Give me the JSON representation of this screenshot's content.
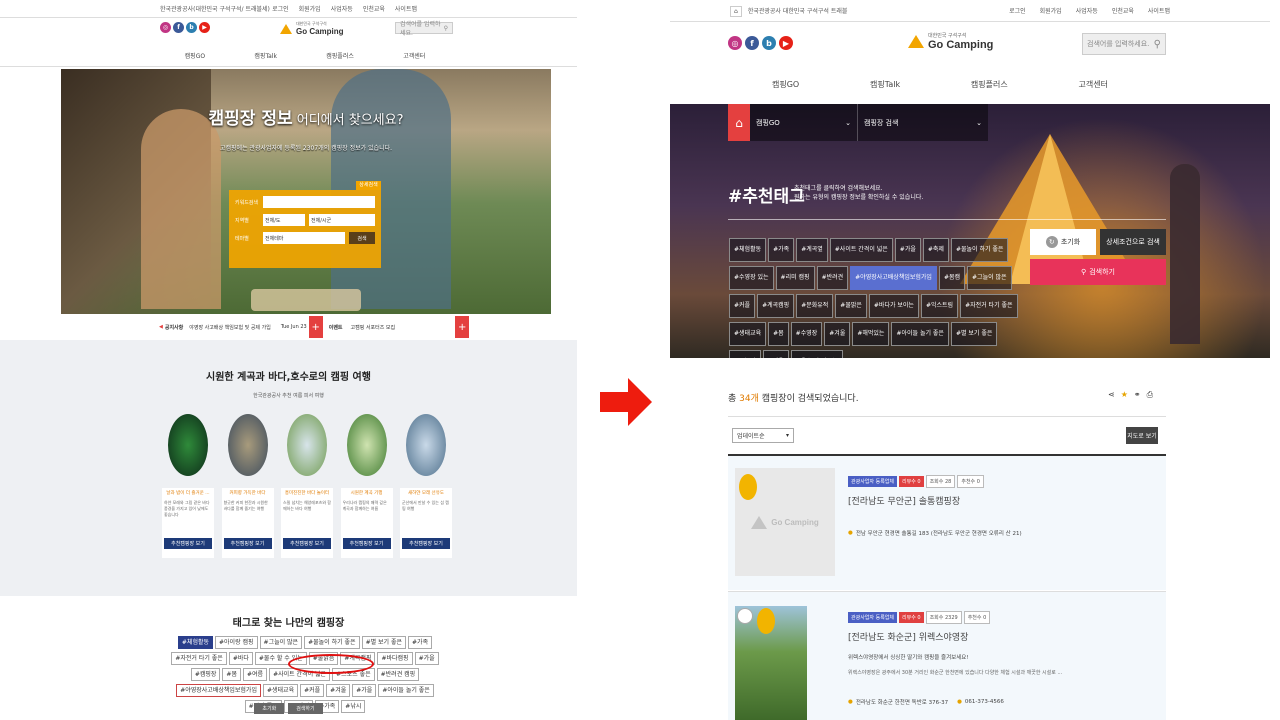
{
  "left": {
    "topbar": {
      "url": "한국관광공사(대한민국 구석구석/ 트래블세)",
      "links": [
        "로그인",
        "회원가입",
        "사업자등",
        "인천교육",
        "사이트맵"
      ]
    },
    "brand": {
      "sub": "대한민국 구석구석",
      "name": "Go Camping"
    },
    "search_placeholder": "검색어를 입력하세요.",
    "nav": [
      "캠핑GO",
      "캠핑Talk",
      "캠핑플러스",
      "고객센터"
    ],
    "hero": {
      "title_1": "캠핑장 정보",
      "title_2": " 어디에서 찾으세요?",
      "subtitle": "고캠핑에는 관광사업자에 등록된 2307개의 캠핑장 정보가 있습니다.",
      "detail_tab": "상세검색",
      "keyword_label": "키워드검색",
      "region_label": "지역별",
      "region_1": "전체/도",
      "region_2": "전체/시군",
      "theme_label": "테마별",
      "theme_value": "전체테마",
      "search_button": "검색"
    },
    "notice": {
      "label": "공지사항",
      "text": "야영장 사고배상 책임보험 및 공제 가입",
      "date": "Tue Jun 23",
      "event_label": "이벤트",
      "event_text": "고캠핑 서포터즈 모집"
    },
    "section1": {
      "title": "시원한 계곡과 바다,호수로의 캠핑 여행",
      "subtitle": "한국관광공사 추천 여름 피서 여행",
      "cards": [
        {
          "title": "날과 밤이 더 즐거운 ...",
          "desc": "하얀 모래와 그림 같은 바다풍경을 가지고 있어 낮에도 좋습니다",
          "btn": "추천캠핑장 보기"
        },
        {
          "title": "커피향 가득한 바다",
          "desc": "향긋한 커피 한잔과 시원한 바다를 함께 즐기는 여행",
          "btn": "추천캠핑장 보기"
        },
        {
          "title": "흥미진진한 바다 놀이터",
          "desc": "스릴 넘치는 해양레포츠와 함께하는 바다 여행",
          "btn": "추천캠핑장 보기"
        },
        {
          "title": "시원한 계곡 기행",
          "desc": "우리나라 캠핑의 매력 깊은 계곡과 함께하는 여름",
          "btn": "추천캠핑장 보기"
        },
        {
          "title": "새하얀 모래 선유도",
          "desc": "군산에서 만날 수 있는 섬 캠핑 여행",
          "btn": "추천캠핑장 보기"
        }
      ]
    },
    "section2": {
      "title": "태그로 찾는 나만의 캠핑장",
      "tags": [
        "#체험활동",
        "#아이랑 캠핑",
        "#그늘이 많은",
        "#물놀이 하기 좋은",
        "#별 보기 좋은",
        "#가족",
        "#자전거 타기 좋은",
        "#바다",
        "#물수 할 수 있는",
        "#물맑음",
        "#계곡캠핑",
        "#바다캠핑",
        "#가을",
        "#캠핑장",
        "#봄",
        "#여름",
        "#사이트 간격이 넓은",
        "#스포츠 좋은",
        "#반려견 캠핑",
        "#야영장사고배상책임보험가입",
        "#생태교육",
        "#커플",
        "#겨울",
        "#가을",
        "#아이들 놀기 좋은",
        "#걷기 좋은",
        "#봄캠핑",
        "#가족",
        "#낚시"
      ],
      "reset": "초기화",
      "search": "검색하기"
    }
  },
  "right": {
    "topbar": {
      "url": "한국관광공사  대한민국 구석구석  트래블",
      "links": [
        "로그인",
        "회원가입",
        "사업자등",
        "인천교육",
        "사이트맵"
      ]
    },
    "brand": {
      "sub": "대한민국 구석구석",
      "name": "Go Camping"
    },
    "search_placeholder": "검색어를 입력하세요.",
    "nav": [
      "캠핑GO",
      "캠핑Talk",
      "캠핑플러스",
      "고객센터"
    ],
    "crumb": {
      "home": "⌂",
      "level1": "캠핑GO",
      "level2": "캠핑장 검색"
    },
    "hero": {
      "title": "#추천태그",
      "desc_1": "추천태그를 클릭하여 검색해보세요.",
      "desc_2": "원하는 유형의 캠핑장 정보를 확인하실 수 있습니다.",
      "tags": [
        "#체험활동",
        "#가족",
        "#계곡옆",
        "#사이트 간격이 넓은",
        "#가을",
        "#축제",
        "#물놀이 하기 좋은",
        "#수영장 있는",
        "#리미 캠핑",
        "#반려견",
        "#야영장사고배상책임보험가입",
        "#봄캠",
        "#그늘이 많은",
        "#커플",
        "#계곡캠핑",
        "#문화유적",
        "#물맑은",
        "#바다가 보이는",
        "#익스트림",
        "#자전거 타기 좋은",
        "#생태교육",
        "#봄",
        "#수영장",
        "#겨울",
        "#해먹있는",
        "#아이들 놀기 좋은",
        "#별 보기 좋은",
        "#물놀이",
        "#겨울",
        "#온수 잘 나오는"
      ],
      "reset": "초기화",
      "detail": "상세조건으로 검색",
      "search": "검색하기"
    },
    "results": {
      "prefix": "총 ",
      "count": "34개",
      "suffix": " 캠핑장이 검색되었습니다.",
      "sort": "업데이트순",
      "map_button": "지도로 보기"
    },
    "items": [
      {
        "badges": [
          "관광사업자 등록업체",
          "리뷰수 0",
          "조회수 28",
          "추천수 0"
        ],
        "title": "[전라남도 무안군] 솔통캠핑장",
        "address": "전남 무안군 현경면 솔통길 183 (전라남도 무안군 현경면 오류리 산 21)",
        "desc": "",
        "phone": "",
        "placeholder": "Go Camping"
      },
      {
        "badges": [
          "관광사업자 등록업체",
          "리뷰수 0",
          "조회수 2329",
          "추천수 0"
        ],
        "title": "[전라남도 화순군] 위렉스야영장",
        "address": "전라남도 화순군 한천면 독반로 376-37",
        "desc_1": "위렉스야영장에서 싱싱한 딸기와 캠핑을 즐겨보세요!",
        "desc_2": "위렉스야영장은 광주에서 30분 거리인 화순군 한천면에 있습니다 다양한 체험 시설과 깨끗한 시설로 ...",
        "phone": "061-373-4566"
      }
    ]
  }
}
